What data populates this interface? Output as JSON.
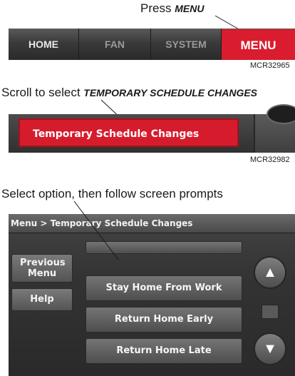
{
  "step1": {
    "callout_prefix": "Press",
    "callout_key": "MENU",
    "tabs": [
      "HOME",
      "FAN",
      "SYSTEM",
      "MENU"
    ],
    "code": "MCR32965"
  },
  "step2": {
    "callout_prefix": "Scroll to select",
    "callout_key": "TEMPORARY SCHEDULE CHANGES",
    "selected_row": "Temporary Schedule Changes",
    "code": "MCR32982"
  },
  "step3": {
    "callout": "Select option, then follow screen prompts",
    "breadcrumb": "Menu > Temporary Schedule Changes",
    "previous_menu": "Previous Menu",
    "help": "Help",
    "options": [
      "Stay Home From Work",
      "Return Home Early",
      "Return Home Late"
    ],
    "up_glyph": "▲",
    "down_glyph": "▼"
  },
  "colors": {
    "accent_red": "#d91c2e",
    "panel_dark": "#2f2f2f",
    "button_grey": "#5e5e5e"
  }
}
